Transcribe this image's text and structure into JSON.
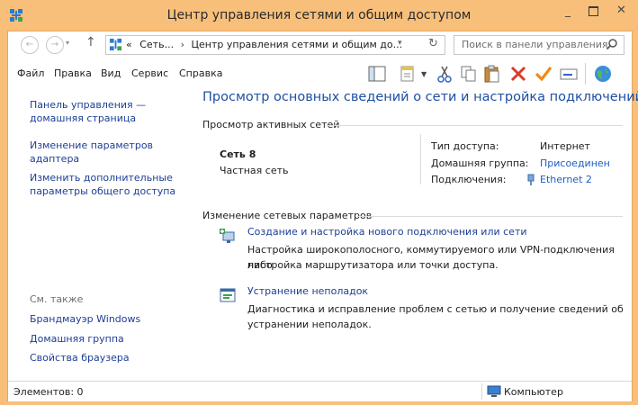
{
  "window": {
    "title": "Центр управления сетями и общим доступом",
    "minimize": "_",
    "close": "✕"
  },
  "address": {
    "prefix": "«",
    "crumbs": [
      "Сеть...",
      "Центр управления сетями и общим до..."
    ],
    "search_placeholder": "Поиск в панели управления"
  },
  "menu": [
    "Файл",
    "Правка",
    "Вид",
    "Сервис",
    "Справка"
  ],
  "toolbar": [
    "layout-icon",
    "properties-icon",
    "cut-icon",
    "copy-icon",
    "paste-icon",
    "delete-icon",
    "check-icon",
    "rename-icon",
    "globe-icon"
  ],
  "sidebar": {
    "links": [
      "Панель управления —",
      "домашняя страница",
      "Изменение параметров",
      "адаптера",
      "Изменить дополнительные",
      "параметры общего доступа"
    ],
    "see_also_label": "См. также",
    "see_also": [
      "Брандмауэр Windows",
      "Домашняя группа",
      "Свойства браузера"
    ]
  },
  "main": {
    "heading": "Просмотр основных сведений о сети и настройка подключений",
    "active_title": "Просмотр активных сетей",
    "network": {
      "name": "Сеть  8",
      "type": "Частная сеть",
      "access_label": "Тип доступа:",
      "access_value": "Интернет",
      "homegroup_label": "Домашняя группа:",
      "homegroup_value": "Присоединен",
      "connections_label": "Подключения:",
      "connections_value": "Ethernet 2"
    },
    "change_title": "Изменение сетевых параметров",
    "tasks": [
      {
        "link": "Создание и настройка нового подключения или сети",
        "desc1": "Настройка широкополосного, коммутируемого или VPN-подключения либо",
        "desc2": "настройка маршрутизатора или точки доступа."
      },
      {
        "link": "Устранение неполадок",
        "desc1": "Диагностика и исправление проблем с сетью и получение сведений об",
        "desc2": "устранении неполадок."
      }
    ]
  },
  "status": {
    "items": "Элементов: 0",
    "location": "Компьютер"
  },
  "colors": {
    "frame": "#f8bf7a",
    "link": "#1c3f95",
    "heading": "#1e4fa3"
  }
}
